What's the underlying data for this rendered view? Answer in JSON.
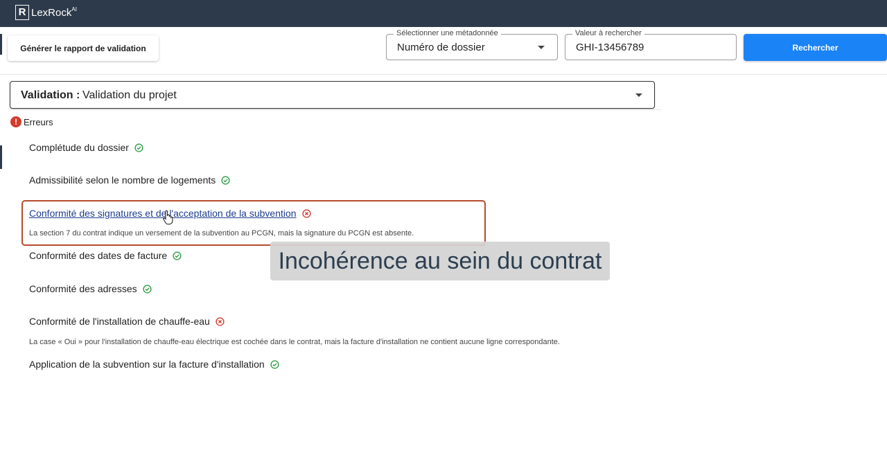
{
  "app": {
    "name": "LexRock",
    "name_sup": "AI",
    "logo_glyph": "R"
  },
  "toolbar": {
    "generate_label": "Générer le rapport de validation",
    "metadata_field_label": "Sélectionner une métadonnée",
    "metadata_value": "Numéro de dossier",
    "search_field_label": "Valeur à rechercher",
    "search_value": "GHI-13456789",
    "search_button": "Rechercher"
  },
  "validation": {
    "label": "Validation :",
    "value": "Validation du projet"
  },
  "errors_label": "Erreurs",
  "checks": [
    {
      "label": "Complétude du dossier",
      "status": "ok"
    },
    {
      "label": "Admissibilité selon le nombre de logements",
      "status": "ok"
    },
    {
      "label": "Conformité des signatures et de l'acceptation de la subvention",
      "status": "error",
      "detail": "La section 7 du contrat indique un versement de la subvention au PCGN, mais la signature du PCGN est absente."
    },
    {
      "label": "Conformité des dates de facture",
      "status": "ok"
    },
    {
      "label": "Conformité des adresses",
      "status": "ok"
    },
    {
      "label": "Conformité de l'installation de chauffe-eau",
      "status": "error",
      "detail": "La case « Oui » pour l'installation de chauffe-eau électrique est cochée dans le contrat, mais la facture d'installation ne contient aucune ligne correspondante."
    },
    {
      "label": "Application de la subvention sur la facture d'installation",
      "status": "ok"
    }
  ],
  "caption": "Incohérence au sein du contrat",
  "colors": {
    "topbar": "#2d3a4b",
    "primary": "#1a83f5",
    "ok": "#2e9e45",
    "error": "#d33b2c",
    "highlight": "#b74a2c"
  },
  "icons": {
    "ok": "check-circle-icon",
    "error": "x-circle-icon",
    "errors": "exclamation-icon"
  }
}
